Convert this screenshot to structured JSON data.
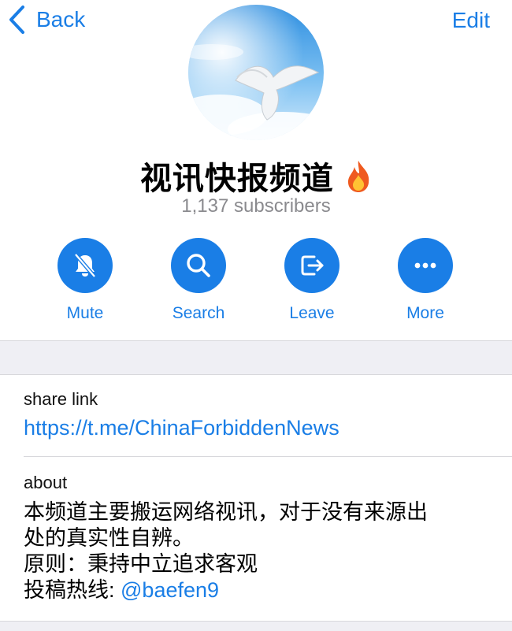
{
  "nav": {
    "back_label": "Back",
    "edit_label": "Edit"
  },
  "channel": {
    "title": "视讯快报频道",
    "title_emoji": "fire-icon",
    "subscribers": "1,137 subscribers",
    "avatar": "dove-in-sky-image"
  },
  "actions": [
    {
      "label": "Mute",
      "icon": "bell-slash-icon"
    },
    {
      "label": "Search",
      "icon": "search-icon"
    },
    {
      "label": "Leave",
      "icon": "leave-icon"
    },
    {
      "label": "More",
      "icon": "more-dots-icon"
    }
  ],
  "share": {
    "label": "share link",
    "url": "https://t.me/ChinaForbiddenNews"
  },
  "about": {
    "label": "about",
    "line1": "本频道主要搬运网络视讯，对于没有来源出",
    "line2": "处的真实性自辨。",
    "line3": "原则：秉持中立追求客观",
    "line4_prefix": "投稿热线: ",
    "line4_handle": "@baefen9"
  },
  "colors": {
    "accent": "#1a7ee6",
    "secondary_text": "#8a8a8e",
    "separator_bg": "#efeff4"
  }
}
